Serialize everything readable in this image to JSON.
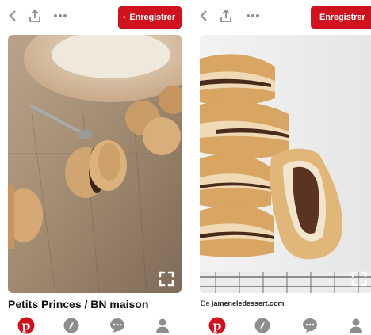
{
  "left": {
    "save_label": "Enregistrer",
    "title": "Petits Princes / BN maison",
    "icons": [
      "back-chevron-icon",
      "share-icon",
      "more-dots-icon",
      "expand-icon"
    ]
  },
  "right": {
    "save_label": "Enregistrer",
    "source_prefix": "De ",
    "source_domain": "jameneledessert.com",
    "icons": [
      "back-chevron-icon",
      "share-icon",
      "more-dots-icon",
      "expand-icon"
    ]
  },
  "tabs": [
    "pinterest-home-icon",
    "explore-compass-icon",
    "messages-icon",
    "profile-icon"
  ],
  "colors": {
    "brand_red": "#d0121f",
    "icon_gray": "#8e8e8e"
  }
}
